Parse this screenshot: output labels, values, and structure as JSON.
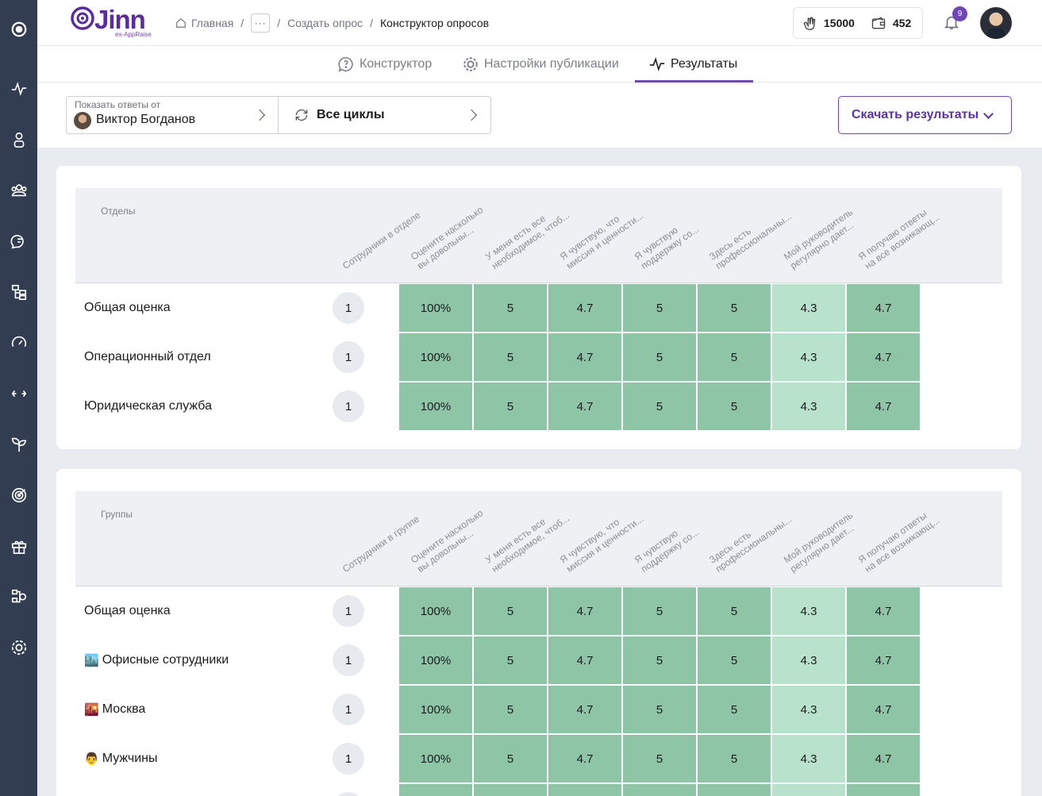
{
  "sidebar": {
    "icons": [
      "logo-swirl-icon",
      "pulse-icon",
      "person-icon",
      "team-icon",
      "feedback-icon",
      "org-structure-icon",
      "speedometer-icon",
      "swap-icon",
      "sprout-icon",
      "target-icon",
      "gift-icon",
      "hierarchy-settings-icon",
      "settings-gear-icon"
    ]
  },
  "header": {
    "logo_text": "Jinn",
    "logo_sub": "ex-AppRaise",
    "breadcrumb": [
      "Главная",
      "Создать опрос",
      "Конструктор опросов"
    ],
    "coins": "15000",
    "wallet": "452",
    "notifications": "9"
  },
  "tabs": [
    {
      "label": "Конструктор",
      "icon": "question-bubble-icon"
    },
    {
      "label": "Настройки публикации",
      "icon": "gear-icon"
    },
    {
      "label": "Результаты",
      "icon": "pulse-icon"
    }
  ],
  "filters": {
    "show_from_label": "Показать ответы от",
    "show_from_value": "Виктор Богданов",
    "cycles_value": "Все циклы",
    "download_label": "Скачать результаты"
  },
  "questions": [
    "Оцените насколько\nвы довольны...",
    "У меня есть все\nнеобходимое, чтоб...",
    "Я чувствую, что\nмиссия и ценности...",
    "Я чувствую\nподдержку со...",
    "Здесь есть\nпрофессиональны...",
    "Мой руководитель\nрегулярно дает...",
    "Я получаю ответы\nна все возникающ..."
  ],
  "departments": {
    "title": "Отделы",
    "count_header": "Сотрудники в отделе",
    "rows": [
      {
        "label": "Общая оценка",
        "count": "1",
        "values": [
          "100%",
          "5",
          "4.7",
          "5",
          "5",
          "4.3",
          "4.7"
        ]
      },
      {
        "label": "Операционный отдел",
        "count": "1",
        "values": [
          "100%",
          "5",
          "4.7",
          "5",
          "5",
          "4.3",
          "4.7"
        ]
      },
      {
        "label": "Юридическая служба",
        "count": "1",
        "values": [
          "100%",
          "5",
          "4.7",
          "5",
          "5",
          "4.3",
          "4.7"
        ]
      }
    ]
  },
  "groups": {
    "title": "Группы",
    "count_header": "Сотрудники в группе",
    "rows": [
      {
        "label": "Общая оценка",
        "emoji": "",
        "count": "1",
        "values": [
          "100%",
          "5",
          "4.7",
          "5",
          "5",
          "4.3",
          "4.7"
        ]
      },
      {
        "label": "Офисные сотрудники",
        "emoji": "🏙️",
        "count": "1",
        "values": [
          "100%",
          "5",
          "4.7",
          "5",
          "5",
          "4.3",
          "4.7"
        ]
      },
      {
        "label": "Москва",
        "emoji": "🌇",
        "count": "1",
        "values": [
          "100%",
          "5",
          "4.7",
          "5",
          "5",
          "4.3",
          "4.7"
        ]
      },
      {
        "label": "Мужчины",
        "emoji": "👨",
        "count": "1",
        "values": [
          "100%",
          "5",
          "4.7",
          "5",
          "5",
          "4.3",
          "4.7"
        ]
      },
      {
        "label": "",
        "emoji": "",
        "count": "",
        "values": [
          "",
          "",
          "",
          "",
          "",
          "",
          ""
        ]
      }
    ]
  },
  "colors": {
    "cell_green": "#8ec5a7",
    "cell_light_green": "#b8e2cc",
    "accent": "#7045b5",
    "sidebar": "#323d51"
  }
}
